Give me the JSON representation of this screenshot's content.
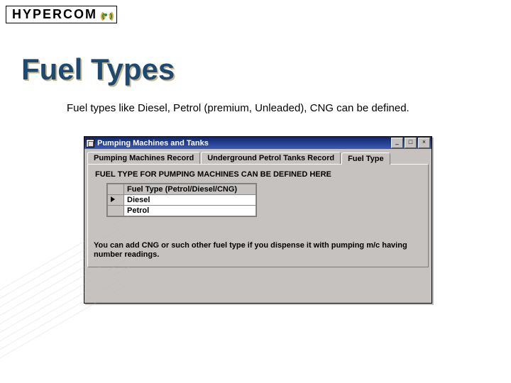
{
  "logo_text": "HYPERCOM",
  "title": "Fuel Types",
  "description": "Fuel types like Diesel, Petrol (premium, Unleaded), CNG can be defined.",
  "window": {
    "title": "Pumping Machines and Tanks",
    "min_label": "_",
    "max_label": "□",
    "close_label": "×",
    "tabs": [
      "Pumping Machines Record",
      "Underground Petrol Tanks Record",
      "Fuel Type"
    ],
    "panel_heading": "FUEL TYPE  FOR PUMPING MACHINES CAN BE DEFINED HERE",
    "grid_header": "Fuel Type (Petrol/Diesel/CNG)",
    "rows": [
      "Diesel",
      "Petrol"
    ],
    "note": "You can add CNG or such other fuel type if you dispense it with pumping m/c having number readings."
  }
}
